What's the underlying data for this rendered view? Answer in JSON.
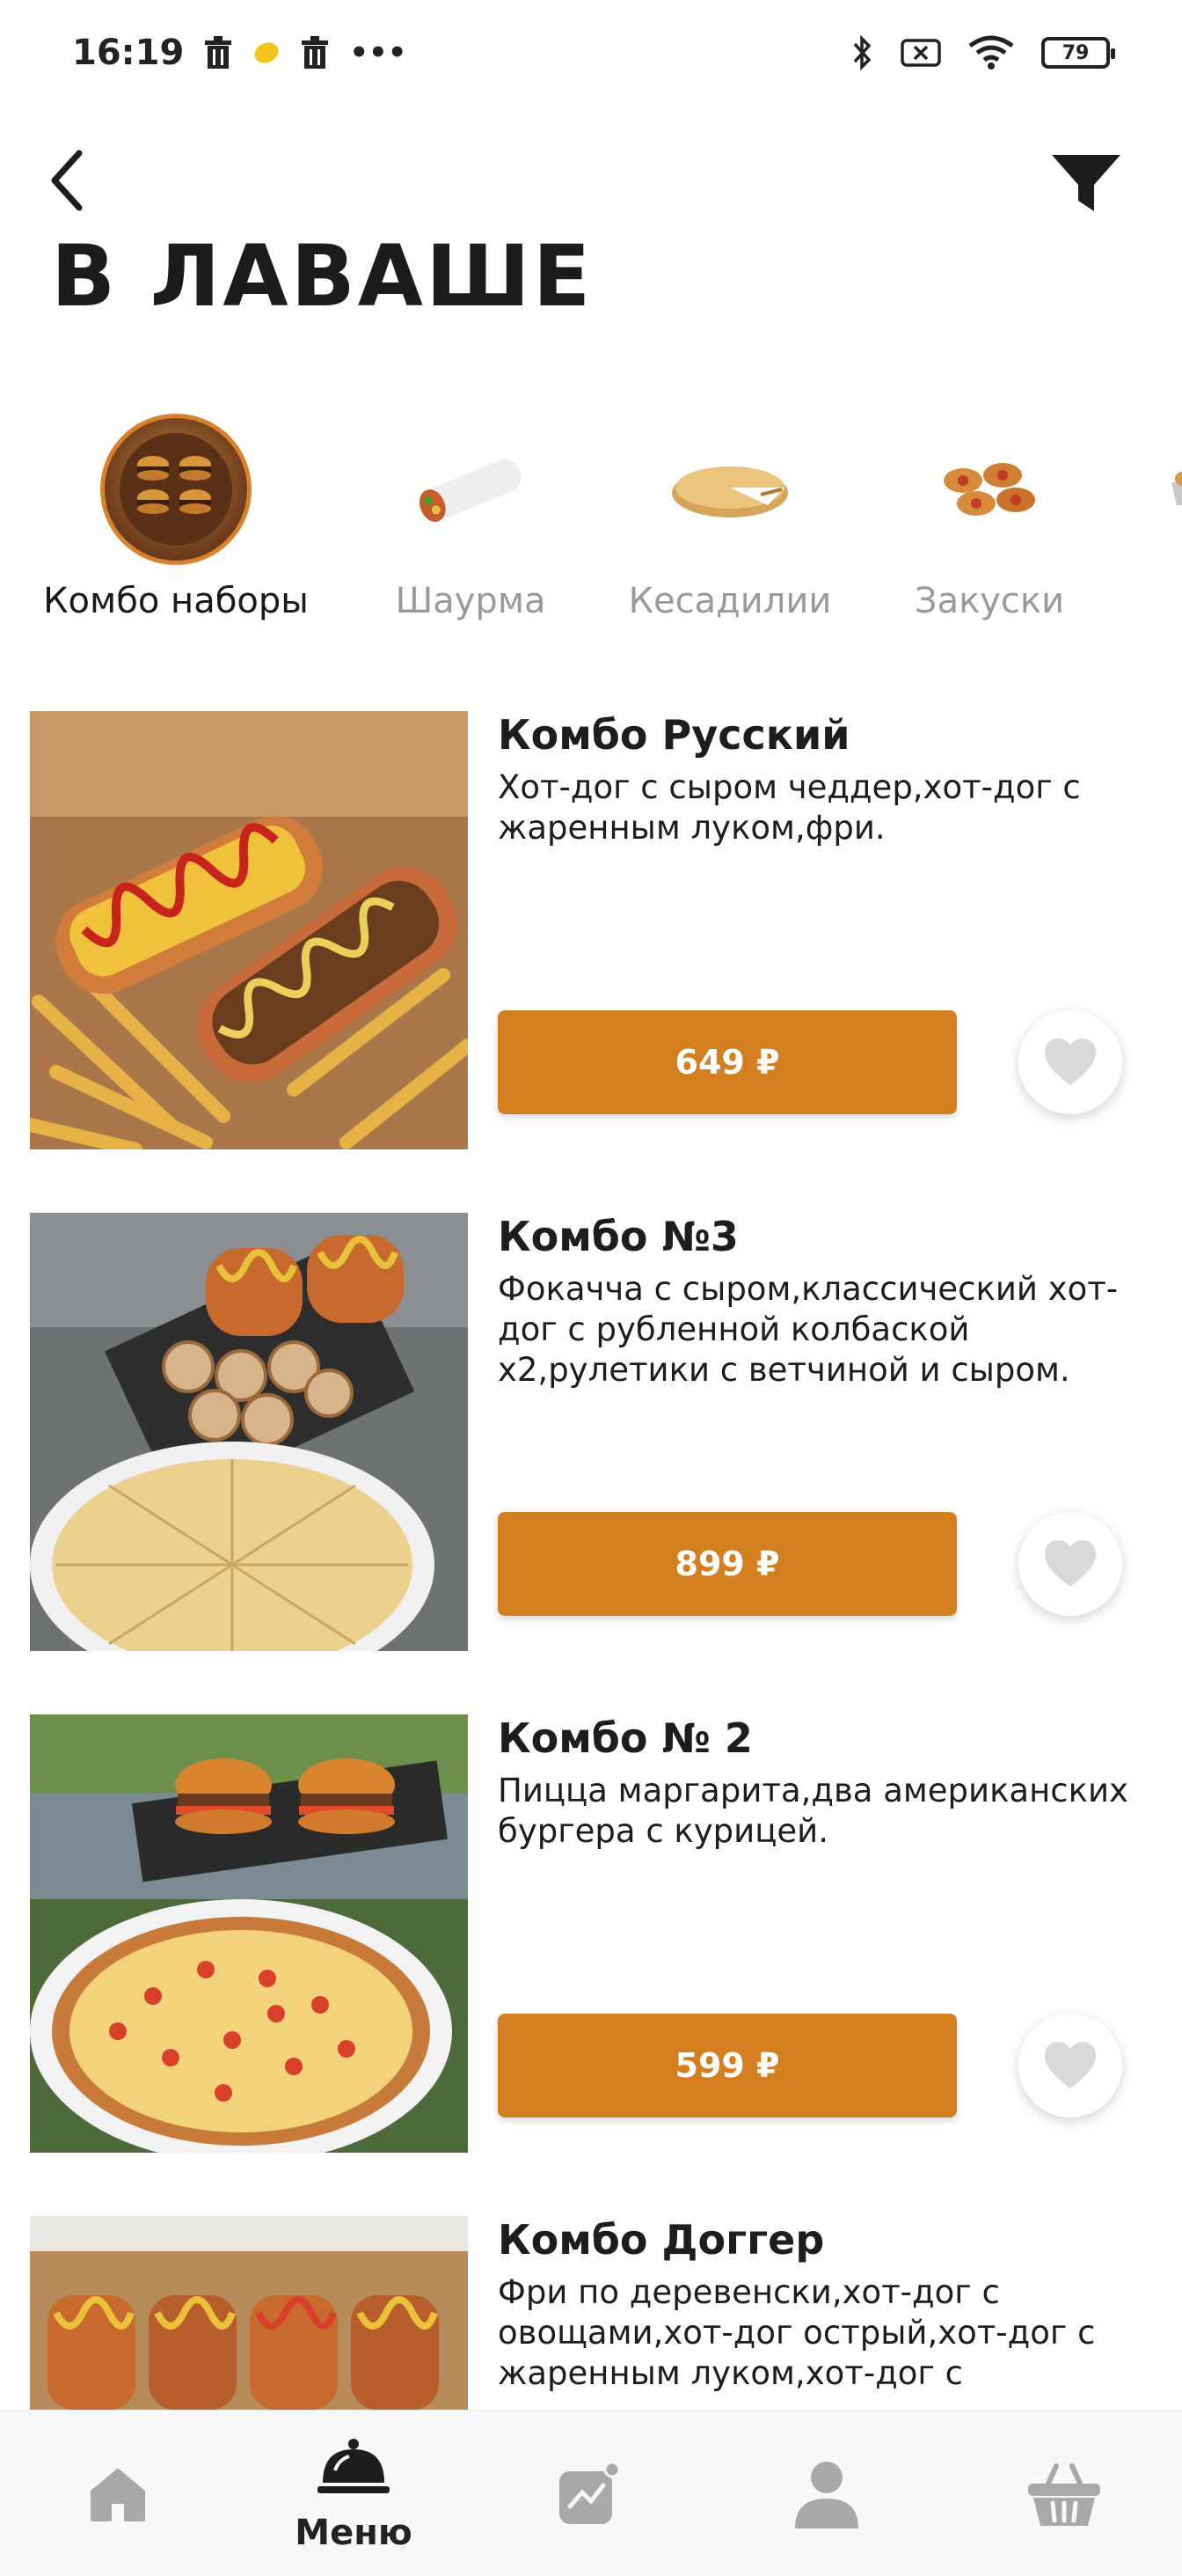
{
  "status_bar": {
    "time": "16:19",
    "battery": "79",
    "more": "•••"
  },
  "header": {
    "title": "В ЛАВАШЕ"
  },
  "categories": [
    {
      "label": "Комбо наборы",
      "active": true,
      "icon": "burger-box-icon"
    },
    {
      "label": "Шаурма",
      "active": false,
      "icon": "shawarma-icon"
    },
    {
      "label": "Кесадилии",
      "active": false,
      "icon": "quesadilla-icon"
    },
    {
      "label": "Закуски",
      "active": false,
      "icon": "snacks-icon"
    }
  ],
  "products": [
    {
      "name": "Комбо Русский",
      "description": "Хот-дог с сыром чеддер,хот-дог с жаренным луком,фри.",
      "price": "649 ₽"
    },
    {
      "name": "Комбо №3",
      "description": "Фокачча с сыром,классический хот-дог с рубленной колбаской х2,рулетики с ветчиной и сыром.",
      "price": "899 ₽"
    },
    {
      "name": "Комбо № 2",
      "description": "Пицца маргарита,два американских бургера с курицей.",
      "price": "599 ₽"
    },
    {
      "name": "Комбо Доггер",
      "description": "Фри по деревенски,хот-дог с овощами,хот-дог острый,хот-дог с жаренным луком,хот-дог с",
      "price": ""
    }
  ],
  "bottom_nav": {
    "menu_label": "Меню"
  },
  "colors": {
    "accent": "#d47f1f",
    "fav_icon": "#d9d9d9"
  }
}
